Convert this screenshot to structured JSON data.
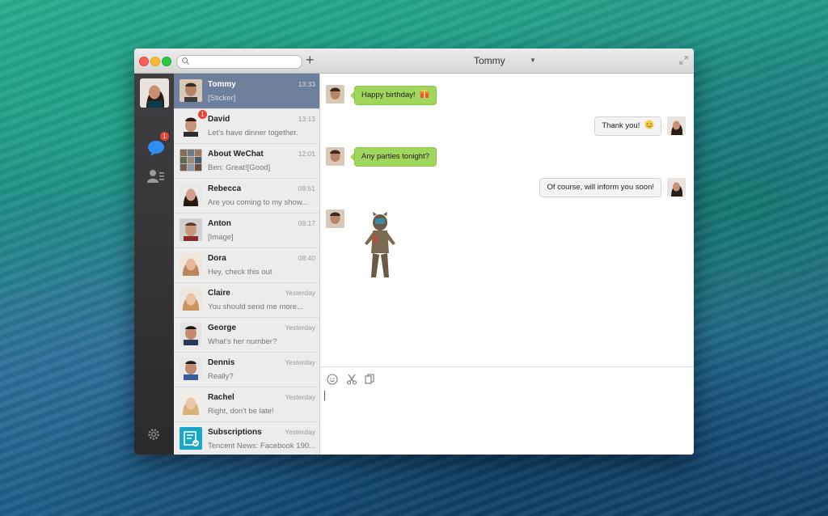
{
  "window": {
    "title": "Tommy"
  },
  "search": {
    "placeholder": ""
  },
  "sidebar": {
    "chats_badge": "1"
  },
  "conversations": [
    {
      "name": "Tommy",
      "time": "13:33",
      "preview": "[Sticker]",
      "active": true
    },
    {
      "name": "David",
      "time": "13:13",
      "preview": "Let's have dinner together.",
      "badge": "1"
    },
    {
      "name": "About WeChat",
      "time": "12:01",
      "preview": "Ben: Great![Good]"
    },
    {
      "name": "Rebecca",
      "time": "09:51",
      "preview": "Are you coming to my show..."
    },
    {
      "name": "Anton",
      "time": "09:17",
      "preview": "[Image]"
    },
    {
      "name": "Dora",
      "time": "08:40",
      "preview": "Hey, check this out"
    },
    {
      "name": "Claire",
      "time": "Yesterday",
      "preview": "You should send me more..."
    },
    {
      "name": "George",
      "time": "Yesterday",
      "preview": "What's her number?"
    },
    {
      "name": "Dennis",
      "time": "Yesterday",
      "preview": "Really?"
    },
    {
      "name": "Rachel",
      "time": "Yesterday",
      "preview": "Right, don't be late!"
    },
    {
      "name": "Subscriptions",
      "time": "Yesterday",
      "preview": "Tencent News: Facebook 190..."
    }
  ],
  "messages": [
    {
      "from": "them",
      "text": "Happy birthday!",
      "emoji": "gift-icon"
    },
    {
      "from": "me",
      "text": "Thank you!",
      "emoji": "blush-icon"
    },
    {
      "from": "them",
      "text": "Any parties tonight?"
    },
    {
      "from": "me",
      "text": "Of course, will inform you soon!"
    },
    {
      "from": "them",
      "sticker": "sticker-character"
    }
  ],
  "colors": {
    "accent_green": "#a0d65b",
    "active_item": "#6e7f9b",
    "badge": "#e94235"
  }
}
